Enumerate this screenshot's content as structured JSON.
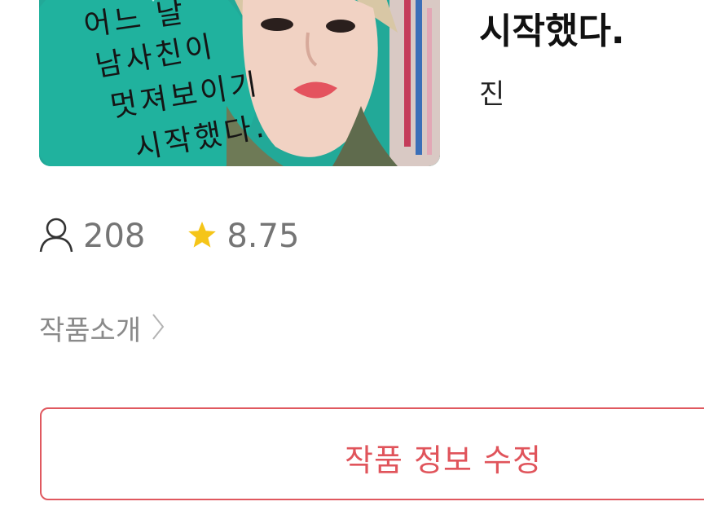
{
  "work": {
    "title": "시작했다.",
    "author": "진",
    "cover": {
      "lines": [
        "어느 날",
        "남사친이",
        "멋져보이기",
        "시작했다."
      ]
    }
  },
  "stats": {
    "readers": "208",
    "rating": "8.75",
    "reader_icon": "person-icon",
    "rating_icon": "star-icon",
    "rating_color": "#f5c518"
  },
  "intro": {
    "label": "작품소개",
    "icon": "chevron-right-icon"
  },
  "edit_button": {
    "label": "작품 정보 수정",
    "color": "#e0545b"
  }
}
